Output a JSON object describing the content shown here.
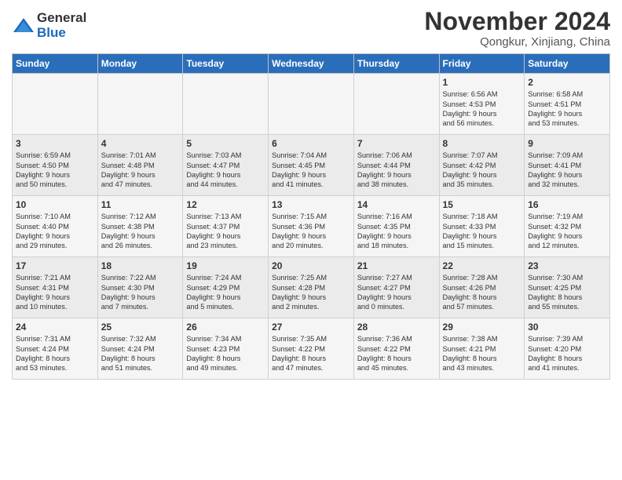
{
  "header": {
    "logo_line1": "General",
    "logo_line2": "Blue",
    "month": "November 2024",
    "location": "Qongkur, Xinjiang, China"
  },
  "weekdays": [
    "Sunday",
    "Monday",
    "Tuesday",
    "Wednesday",
    "Thursday",
    "Friday",
    "Saturday"
  ],
  "weeks": [
    [
      {
        "day": "",
        "info": ""
      },
      {
        "day": "",
        "info": ""
      },
      {
        "day": "",
        "info": ""
      },
      {
        "day": "",
        "info": ""
      },
      {
        "day": "",
        "info": ""
      },
      {
        "day": "1",
        "info": "Sunrise: 6:56 AM\nSunset: 4:53 PM\nDaylight: 9 hours\nand 56 minutes."
      },
      {
        "day": "2",
        "info": "Sunrise: 6:58 AM\nSunset: 4:51 PM\nDaylight: 9 hours\nand 53 minutes."
      }
    ],
    [
      {
        "day": "3",
        "info": "Sunrise: 6:59 AM\nSunset: 4:50 PM\nDaylight: 9 hours\nand 50 minutes."
      },
      {
        "day": "4",
        "info": "Sunrise: 7:01 AM\nSunset: 4:48 PM\nDaylight: 9 hours\nand 47 minutes."
      },
      {
        "day": "5",
        "info": "Sunrise: 7:03 AM\nSunset: 4:47 PM\nDaylight: 9 hours\nand 44 minutes."
      },
      {
        "day": "6",
        "info": "Sunrise: 7:04 AM\nSunset: 4:45 PM\nDaylight: 9 hours\nand 41 minutes."
      },
      {
        "day": "7",
        "info": "Sunrise: 7:06 AM\nSunset: 4:44 PM\nDaylight: 9 hours\nand 38 minutes."
      },
      {
        "day": "8",
        "info": "Sunrise: 7:07 AM\nSunset: 4:42 PM\nDaylight: 9 hours\nand 35 minutes."
      },
      {
        "day": "9",
        "info": "Sunrise: 7:09 AM\nSunset: 4:41 PM\nDaylight: 9 hours\nand 32 minutes."
      }
    ],
    [
      {
        "day": "10",
        "info": "Sunrise: 7:10 AM\nSunset: 4:40 PM\nDaylight: 9 hours\nand 29 minutes."
      },
      {
        "day": "11",
        "info": "Sunrise: 7:12 AM\nSunset: 4:38 PM\nDaylight: 9 hours\nand 26 minutes."
      },
      {
        "day": "12",
        "info": "Sunrise: 7:13 AM\nSunset: 4:37 PM\nDaylight: 9 hours\nand 23 minutes."
      },
      {
        "day": "13",
        "info": "Sunrise: 7:15 AM\nSunset: 4:36 PM\nDaylight: 9 hours\nand 20 minutes."
      },
      {
        "day": "14",
        "info": "Sunrise: 7:16 AM\nSunset: 4:35 PM\nDaylight: 9 hours\nand 18 minutes."
      },
      {
        "day": "15",
        "info": "Sunrise: 7:18 AM\nSunset: 4:33 PM\nDaylight: 9 hours\nand 15 minutes."
      },
      {
        "day": "16",
        "info": "Sunrise: 7:19 AM\nSunset: 4:32 PM\nDaylight: 9 hours\nand 12 minutes."
      }
    ],
    [
      {
        "day": "17",
        "info": "Sunrise: 7:21 AM\nSunset: 4:31 PM\nDaylight: 9 hours\nand 10 minutes."
      },
      {
        "day": "18",
        "info": "Sunrise: 7:22 AM\nSunset: 4:30 PM\nDaylight: 9 hours\nand 7 minutes."
      },
      {
        "day": "19",
        "info": "Sunrise: 7:24 AM\nSunset: 4:29 PM\nDaylight: 9 hours\nand 5 minutes."
      },
      {
        "day": "20",
        "info": "Sunrise: 7:25 AM\nSunset: 4:28 PM\nDaylight: 9 hours\nand 2 minutes."
      },
      {
        "day": "21",
        "info": "Sunrise: 7:27 AM\nSunset: 4:27 PM\nDaylight: 9 hours\nand 0 minutes."
      },
      {
        "day": "22",
        "info": "Sunrise: 7:28 AM\nSunset: 4:26 PM\nDaylight: 8 hours\nand 57 minutes."
      },
      {
        "day": "23",
        "info": "Sunrise: 7:30 AM\nSunset: 4:25 PM\nDaylight: 8 hours\nand 55 minutes."
      }
    ],
    [
      {
        "day": "24",
        "info": "Sunrise: 7:31 AM\nSunset: 4:24 PM\nDaylight: 8 hours\nand 53 minutes."
      },
      {
        "day": "25",
        "info": "Sunrise: 7:32 AM\nSunset: 4:24 PM\nDaylight: 8 hours\nand 51 minutes."
      },
      {
        "day": "26",
        "info": "Sunrise: 7:34 AM\nSunset: 4:23 PM\nDaylight: 8 hours\nand 49 minutes."
      },
      {
        "day": "27",
        "info": "Sunrise: 7:35 AM\nSunset: 4:22 PM\nDaylight: 8 hours\nand 47 minutes."
      },
      {
        "day": "28",
        "info": "Sunrise: 7:36 AM\nSunset: 4:22 PM\nDaylight: 8 hours\nand 45 minutes."
      },
      {
        "day": "29",
        "info": "Sunrise: 7:38 AM\nSunset: 4:21 PM\nDaylight: 8 hours\nand 43 minutes."
      },
      {
        "day": "30",
        "info": "Sunrise: 7:39 AM\nSunset: 4:20 PM\nDaylight: 8 hours\nand 41 minutes."
      }
    ]
  ]
}
